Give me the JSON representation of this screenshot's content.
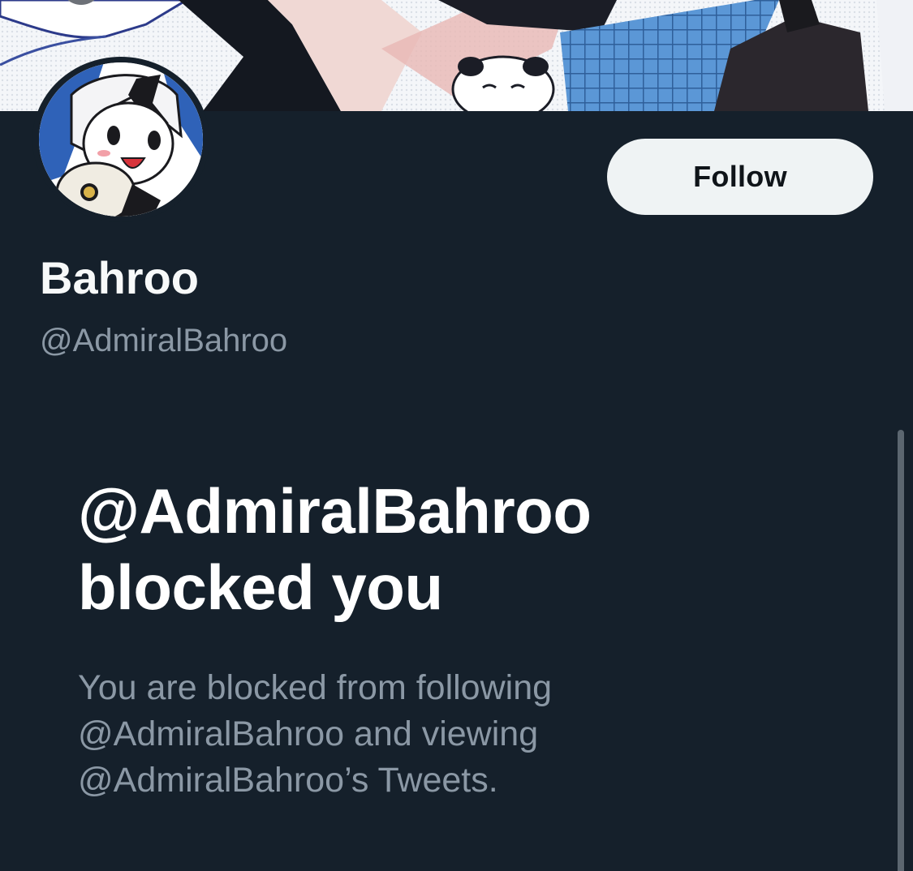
{
  "profile": {
    "display_name": "Bahroo",
    "handle": "@AdmiralBahroo",
    "follow_label": "Follow"
  },
  "block_notice": {
    "title_line1": "@AdmiralBahroo",
    "title_line2": "blocked you",
    "desc_line1": "You are blocked from following",
    "desc_line2": "@AdmiralBahroo and viewing",
    "desc_line3": "@AdmiralBahroo’s Tweets."
  },
  "colors": {
    "background": "#15202b",
    "primary_text": "#f7f9f9",
    "secondary_text": "#8b98a5",
    "follow_button_bg": "#eff3f4",
    "follow_button_text": "#0f1419"
  },
  "icons": {
    "banner": "anime-banner-image",
    "avatar": "cartoon-avatar-image"
  }
}
